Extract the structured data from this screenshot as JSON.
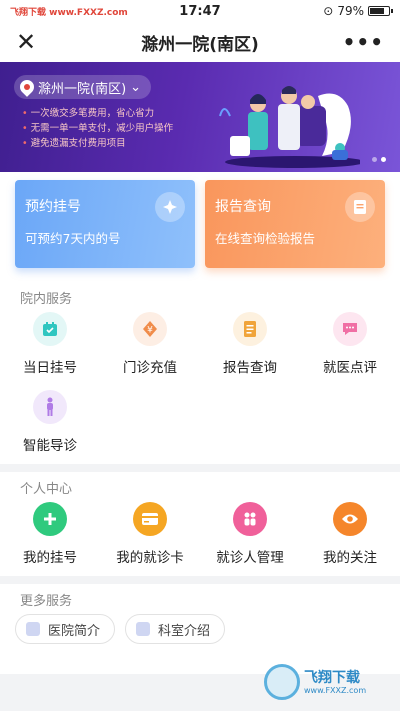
{
  "status_bar": {
    "carrier": "飞翔下载 www.FXXZ.com",
    "time": "17:47",
    "battery": "79%"
  },
  "navbar": {
    "title": "滁州一院(南区)"
  },
  "banner": {
    "hospital": "滁州一院(南区)",
    "bullets": [
      "一次缴交多笔费用，省心省力",
      "无需一单一单支付，减少用户操作",
      "避免遗漏支付费用项目"
    ]
  },
  "cards": [
    {
      "title": "预约挂号",
      "subtitle": "可预约7天内的号"
    },
    {
      "title": "报告查询",
      "subtitle": "在线查询检验报告"
    }
  ],
  "sections": {
    "in_hospital": {
      "title": "院内服务",
      "items": [
        {
          "label": "当日挂号",
          "icon": "calendar-icon",
          "color": "#2fc6c0"
        },
        {
          "label": "门诊充值",
          "icon": "yen-icon",
          "color": "#f08c4a"
        },
        {
          "label": "报告查询",
          "icon": "report-icon",
          "color": "#f0a43a"
        },
        {
          "label": "就医点评",
          "icon": "chat-icon",
          "color": "#f06fa4"
        },
        {
          "label": "智能导诊",
          "icon": "person-icon",
          "color": "#b07be6"
        }
      ]
    },
    "personal": {
      "title": "个人中心",
      "items": [
        {
          "label": "我的挂号",
          "icon": "plus-icon",
          "color": "#2fca7e"
        },
        {
          "label": "我的就诊卡",
          "icon": "card-icon",
          "color": "#f5a623"
        },
        {
          "label": "就诊人管理",
          "icon": "people-icon",
          "color": "#f0609a"
        },
        {
          "label": "我的关注",
          "icon": "eye-icon",
          "color": "#f5862b"
        }
      ]
    },
    "more": {
      "title": "更多服务",
      "pills": [
        "医院简介",
        "科室介绍"
      ]
    }
  },
  "watermark": {
    "text": "飞翔下载",
    "url": "www.FXXZ.com"
  }
}
